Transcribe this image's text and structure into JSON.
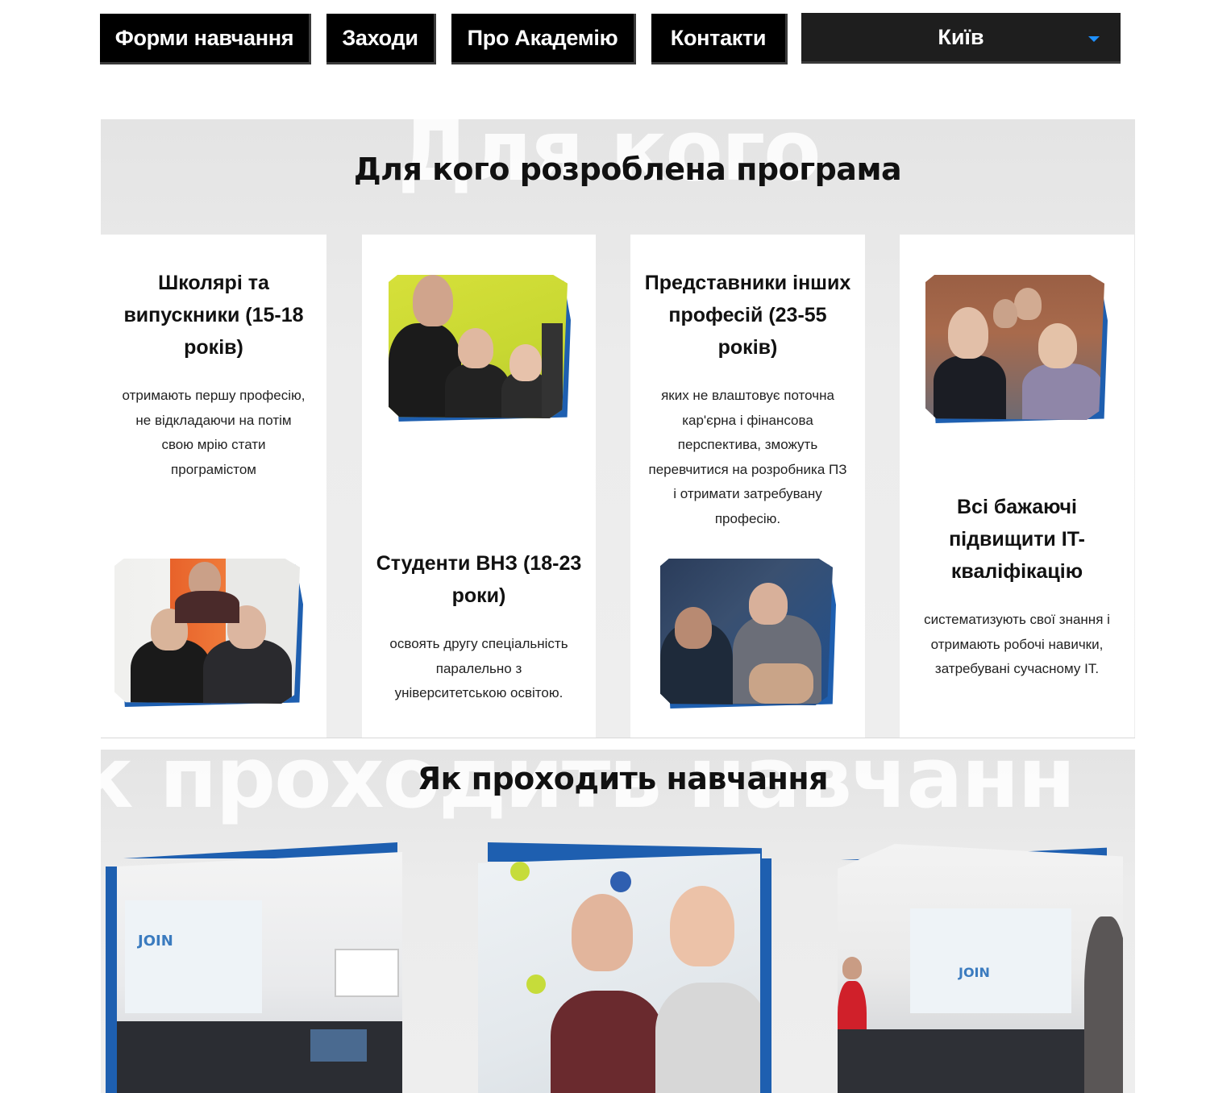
{
  "nav": {
    "items": [
      "Форми навчання",
      "Заходи",
      "Про Академію",
      "Контакти"
    ],
    "city": "Київ"
  },
  "section_audience": {
    "watermark": "Для кого",
    "title": "Для кого розроблена програма",
    "cards": [
      {
        "title": "Школярі та випускники (15-18 років)",
        "text": "отримають першу професію, не відкладаючи на потім свою мрію стати програмістом"
      },
      {
        "title": "Студенти ВНЗ (18-23 роки)",
        "text": "освоять другу спеціальність паралельно з університетською освітою."
      },
      {
        "title": "Представники інших професій (23-55 років)",
        "text": "яких не влаштовує поточна кар'єрна і фінансова перспектива, зможуть перевчитися на розробника ПЗ і отримати затребувану професію."
      },
      {
        "title": "Всі бажаючі підвищити IT-кваліфікацію",
        "text": "систематизують свої знання і отримають робочі навички, затребувані сучасному IT."
      }
    ]
  },
  "section_learning": {
    "watermark": "к проходить навчанн",
    "title": "Як проходить навчання"
  },
  "colors": {
    "nav_bg": "#000000",
    "accent_blue": "#1e5fb0",
    "section_bg": "#ececec"
  }
}
